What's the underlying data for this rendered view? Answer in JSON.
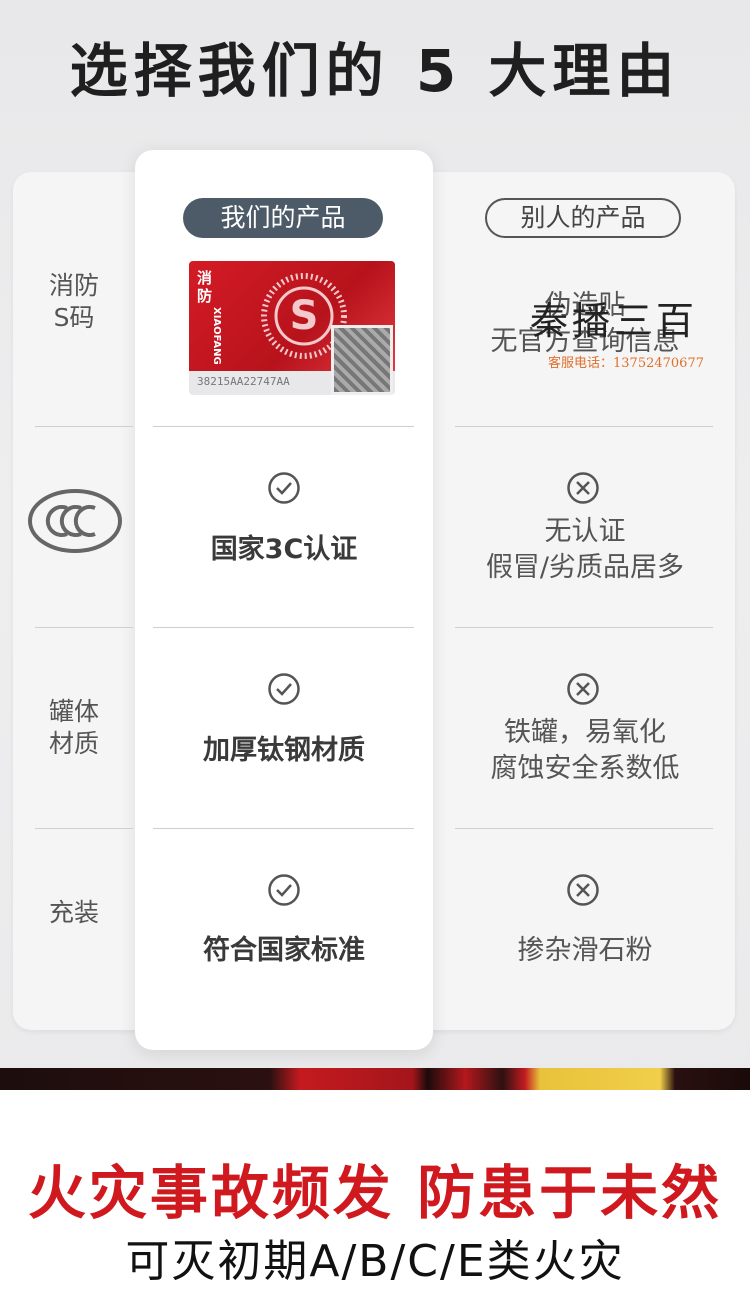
{
  "header": {
    "title": "选择我们的 5 大理由"
  },
  "columns": {
    "ours": "我们的产品",
    "theirs": "别人的产品"
  },
  "rows": [
    {
      "label": "消防\nS码",
      "ours": "",
      "theirs": "伪造贴\n无官方查询信息"
    },
    {
      "label": "",
      "label_icon": "ccc-certification-icon",
      "ours": "国家3C认证",
      "theirs": "无认证\n假冒/劣质品居多"
    },
    {
      "label": "罐体\n材质",
      "ours": "加厚钛钢材质",
      "theirs": "铁罐，易氧化\n腐蚀安全系数低"
    },
    {
      "label": "充装",
      "ours": "符合国家标准",
      "theirs": "掺杂滑石粉"
    }
  ],
  "seal": {
    "side_text": "消防",
    "vertical_text": "XIAOFANG",
    "code": "38215AA22747AA"
  },
  "watermark": {
    "name": "秦播三百",
    "phone": "客服电话：13752470677"
  },
  "footer": {
    "slogan": "火灾事故频发 防患于未然",
    "subline": "可灭初期A/B/C/E类火灾"
  },
  "colors": {
    "accent": "#d0181f",
    "ours_pill": "#4d5b68",
    "seal_red": "#c8161e"
  }
}
